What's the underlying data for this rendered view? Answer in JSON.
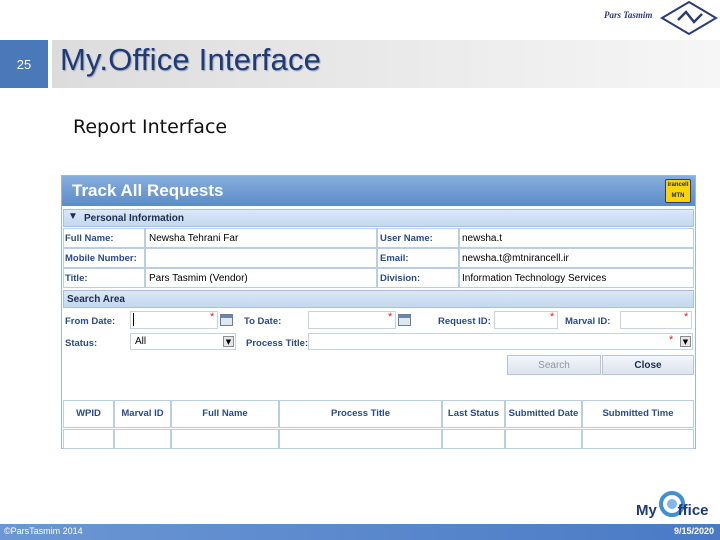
{
  "slide": {
    "number": "25",
    "title": "My.Office Interface",
    "subtitle": "Report Interface",
    "brand_text": "Pars Tasmim",
    "footer_left": "©ParsTasmim 2014",
    "footer_right": "9/15/2020",
    "logo_text": "My Office"
  },
  "app": {
    "title": "Track All Requests",
    "brand_badge": "Irancell MTN",
    "personal_section": {
      "label": "Personal Information",
      "fields": {
        "full_name_label": "Full Name:",
        "full_name_value": "Newsha Tehrani Far",
        "user_name_label": "User Name:",
        "user_name_value": "newsha.t",
        "mobile_label": "Mobile Number:",
        "mobile_value": "",
        "email_label": "Email:",
        "email_value": "newsha.t@mtnirancell.ir",
        "title_label": "Title:",
        "title_value": "Pars Tasmim (Vendor)",
        "division_label": "Division:",
        "division_value": "Information Technology Services"
      }
    },
    "search_section": {
      "label": "Search Area",
      "from_date_label": "From Date:",
      "to_date_label": "To Date:",
      "request_id_label": "Request ID:",
      "marval_id_label": "Marval ID:",
      "status_label": "Status:",
      "status_value": "All",
      "process_title_label": "Process Title:",
      "search_button": "Search",
      "close_button": "Close"
    },
    "results_table": {
      "columns": [
        "WPID",
        "Marval ID",
        "Full Name",
        "Process Title",
        "Last Status",
        "Submitted Date",
        "Submitted Time"
      ]
    }
  },
  "colors": {
    "header_blue": "#5d8bc8",
    "title_navy": "#1e3a78",
    "label_blue": "#2a4a8a",
    "required_red": "#e02020"
  }
}
